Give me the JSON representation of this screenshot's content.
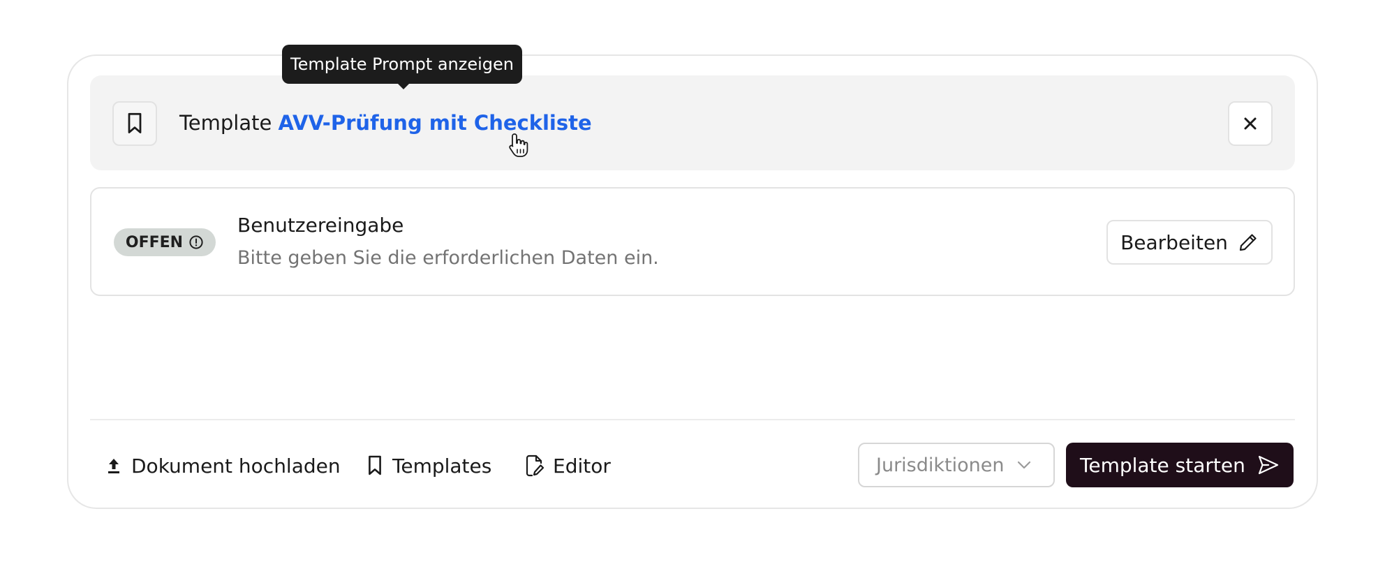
{
  "tooltip": {
    "text": "Template Prompt anzeigen"
  },
  "template_bar": {
    "prefix": "Template",
    "name": "AVV-Prüfung mit Checkliste"
  },
  "user_input": {
    "status": "OFFEN",
    "title": "Benutzereingabe",
    "subtitle": "Bitte geben Sie die erforderlichen Daten ein.",
    "edit_label": "Bearbeiten"
  },
  "toolbar": {
    "upload_label": "Dokument hochladen",
    "templates_label": "Templates",
    "editor_label": "Editor",
    "jurisdictions_placeholder": "Jurisdiktionen",
    "start_label": "Template starten"
  },
  "icons": {
    "bookmark": "bookmark-icon",
    "close": "close-icon",
    "alert": "alert-circle-icon",
    "pencil": "pencil-icon",
    "upload": "upload-icon",
    "editor": "file-edit-icon",
    "chevron": "chevron-down-icon",
    "send": "send-icon"
  },
  "colors": {
    "link": "#1f63e8",
    "primary_button": "#1f0e19",
    "badge_bg": "#d3d8d5",
    "tooltip_bg": "#1c1c1c"
  }
}
